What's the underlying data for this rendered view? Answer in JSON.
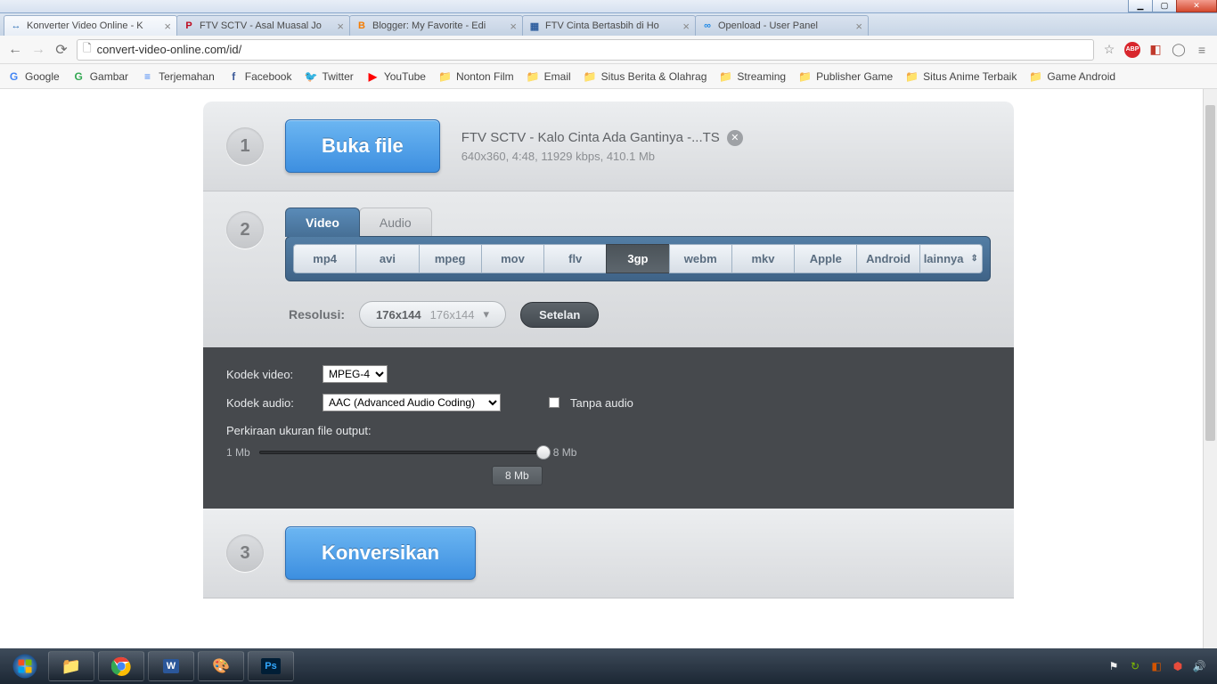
{
  "window": {
    "min": "▁",
    "max": "▢",
    "close": "✕"
  },
  "tabs": [
    {
      "fav": "↔",
      "favcolor": "#2b6fb5",
      "label": "Konverter Video Online - K"
    },
    {
      "fav": "P",
      "favcolor": "#bd081c",
      "label": "FTV SCTV - Asal Muasal Jo"
    },
    {
      "fav": "B",
      "favcolor": "#f57c00",
      "label": "Blogger: My Favorite - Edi"
    },
    {
      "fav": "▦",
      "favcolor": "#2e5e9e",
      "label": "FTV Cinta Bertasbih di Ho"
    },
    {
      "fav": "∞",
      "favcolor": "#1e88e5",
      "label": "Openload - User Panel"
    }
  ],
  "url": "convert-video-online.com/id/",
  "bookmarks": [
    {
      "ic": "G",
      "col": "#4285f4",
      "label": "Google"
    },
    {
      "ic": "G",
      "col": "#34a853",
      "label": "Gambar"
    },
    {
      "ic": "≡",
      "col": "#4285f4",
      "label": "Terjemahan"
    },
    {
      "ic": "f",
      "col": "#3b5998",
      "label": "Facebook"
    },
    {
      "ic": "🐦",
      "col": "#1da1f2",
      "label": "Twitter"
    },
    {
      "ic": "▶",
      "col": "#ff0000",
      "label": "YouTube"
    },
    {
      "ic": "📁",
      "col": "",
      "label": "Nonton Film"
    },
    {
      "ic": "📁",
      "col": "",
      "label": "Email"
    },
    {
      "ic": "📁",
      "col": "",
      "label": "Situs Berita & Olahrag"
    },
    {
      "ic": "📁",
      "col": "",
      "label": "Streaming"
    },
    {
      "ic": "📁",
      "col": "",
      "label": "Publisher Game"
    },
    {
      "ic": "📁",
      "col": "",
      "label": "Situs Anime Terbaik"
    },
    {
      "ic": "📁",
      "col": "",
      "label": "Game Android"
    }
  ],
  "step1": {
    "num": "1",
    "btn": "Buka file",
    "filename": "FTV SCTV - Kalo Cinta Ada Gantinya -...TS",
    "details": "640x360, 4:48, 11929 kbps, 410.1 Mb"
  },
  "step2": {
    "num": "2",
    "tabs": {
      "video": "Video",
      "audio": "Audio"
    },
    "formats": [
      "mp4",
      "avi",
      "mpeg",
      "mov",
      "flv",
      "3gp",
      "webm",
      "mkv",
      "Apple",
      "Android",
      "lainnya"
    ],
    "active_format": "3gp",
    "res_label": "Resolusi:",
    "res_main": "176x144",
    "res_sub": "176x144",
    "settings": "Setelan"
  },
  "advanced": {
    "vcodec_label": "Kodek video:",
    "vcodec": "MPEG-4",
    "acodec_label": "Kodek audio:",
    "acodec": "AAC (Advanced Audio Coding)",
    "noaudio": "Tanpa audio",
    "est_label": "Perkiraan ukuran file output:",
    "min": "1 Mb",
    "max": "8 Mb",
    "val": "8 Mb"
  },
  "step3": {
    "num": "3",
    "btn": "Konversikan"
  },
  "abp": "ABP"
}
